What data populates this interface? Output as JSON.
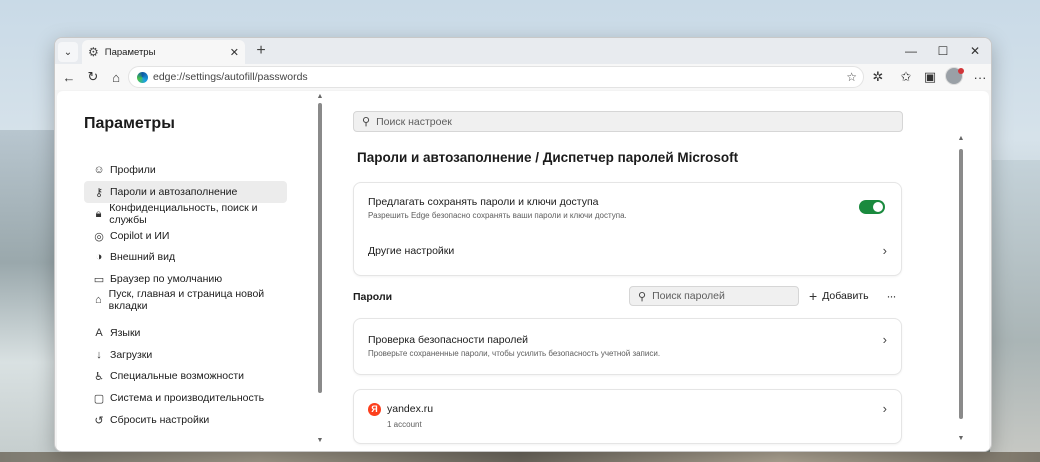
{
  "browser": {
    "tab_title": "Параметры",
    "url": "edge://settings/autofill/passwords",
    "icons": {
      "tab_dropdown": "chevron-down-icon",
      "tab": "gear-icon",
      "tab_close": "close-icon",
      "new_tab": "plus-icon",
      "back": "back-arrow-icon",
      "refresh": "refresh-icon",
      "home": "home-icon",
      "favorite": "star-icon",
      "extensions": "puzzle-icon",
      "favorites": "favorites-icon",
      "collections": "collections-icon",
      "profile": "avatar-icon",
      "menu": "more-icon"
    }
  },
  "sidebar": {
    "title": "Параметры",
    "items": [
      {
        "label": "Профили",
        "icon": "profile-icon"
      },
      {
        "label": "Пароли и автозаполнение",
        "icon": "key-icon",
        "active": true
      },
      {
        "label": "Конфиденциальность, поиск и службы",
        "icon": "lock-icon"
      },
      {
        "label": "Copilot и ИИ",
        "icon": "copilot-icon"
      },
      {
        "label": "Внешний вид",
        "icon": "appearance-icon"
      },
      {
        "label": "Браузер по умолчанию",
        "icon": "browser-icon"
      },
      {
        "label": "Пуск, главная и страница новой вкладки",
        "icon": "home-icon"
      },
      {
        "label": "Языки",
        "icon": "languages-icon"
      },
      {
        "label": "Загрузки",
        "icon": "download-icon"
      },
      {
        "label": "Специальные возможности",
        "icon": "accessibility-icon"
      },
      {
        "label": "Система и производительность",
        "icon": "system-icon"
      },
      {
        "label": "Сбросить настройки",
        "icon": "reset-icon"
      }
    ]
  },
  "main": {
    "search_placeholder": "Поиск настроек",
    "title": "Пароли и автозаполнение / Диспетчер паролей Microsoft",
    "offer_save": {
      "title": "Предлагать сохранять пароли и ключи доступа",
      "subtitle": "Разрешить Edge безопасно сохранять ваши пароли и ключи доступа.",
      "enabled": true
    },
    "other_settings": "Другие настройки",
    "passwords_section": {
      "label": "Пароли",
      "search_placeholder": "Поиск паролей",
      "add_label": "Добавить",
      "more_label": "···"
    },
    "security_check": {
      "title": "Проверка безопасности паролей",
      "subtitle": "Проверьте сохраненные пароли, чтобы усилить безопасность учетной записи."
    },
    "saved_sites": [
      {
        "site": "yandex.ru",
        "accounts": "1 account",
        "icon_letter": "Я"
      }
    ]
  },
  "colors": {
    "toggle_on": "#1a8a3e",
    "yandex": "#fc3f1d",
    "active_bar": "#1b1b1b"
  }
}
